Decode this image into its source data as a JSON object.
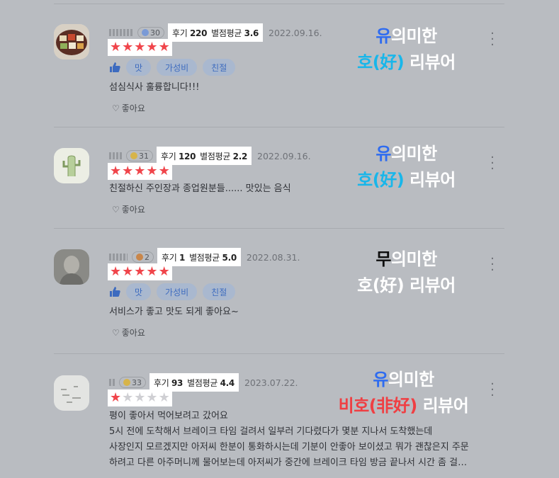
{
  "actions": {
    "like_label": "좋아요",
    "more_label": "⋮"
  },
  "reviews": [
    {
      "level": "30",
      "level_color": "#7a9ad6",
      "review_label": "후기",
      "review_count": "220",
      "avg_label": "별점평균",
      "avg_rating": "3.6",
      "date": "2022.09.16.",
      "stars_filled": 5,
      "tags": [
        "맛",
        "가성비",
        "친절"
      ],
      "text_lines": [
        "섬심식사 훌륭합니다!!!"
      ],
      "annotation": {
        "line1_colored": "유",
        "line1_rest": "의미한",
        "line2_colored": "호(好)",
        "line2_rest": " 리뷰어",
        "color1": "blue",
        "color2": "cyan"
      }
    },
    {
      "level": "31",
      "level_color": "#d7b44a",
      "review_label": "후기",
      "review_count": "120",
      "avg_label": "별점평균",
      "avg_rating": "2.2",
      "date": "2022.09.16.",
      "stars_filled": 5,
      "tags": [],
      "text_lines": [
        "친절하신 주인장과 종업원분들...... 맛있는 음식"
      ],
      "annotation": {
        "line1_colored": "유",
        "line1_rest": "의미한",
        "line2_colored": "호(好)",
        "line2_rest": " 리뷰어",
        "color1": "blue",
        "color2": "cyan"
      }
    },
    {
      "level": "2",
      "level_color": "#c9864a",
      "review_label": "후기",
      "review_count": "1",
      "avg_label": "별점평균",
      "avg_rating": "5.0",
      "date": "2022.08.31.",
      "stars_filled": 5,
      "tags": [
        "맛",
        "가성비",
        "친절"
      ],
      "text_lines": [
        "서비스가 좋고 맛도 되게 좋아요~"
      ],
      "annotation": {
        "line1_colored": "무",
        "line1_rest": "의미한",
        "line2_colored": "호(好)",
        "line2_rest": " 리뷰어",
        "color1": "black",
        "color2": "white"
      }
    },
    {
      "level": "33",
      "level_color": "#d7b44a",
      "review_label": "후기",
      "review_count": "93",
      "avg_label": "별점평균",
      "avg_rating": "4.4",
      "date": "2023.07.22.",
      "stars_filled": 1,
      "tags": [],
      "text_lines": [
        "평이 좋아서 먹어보려고 갔어요",
        "5시 전에 도착해서 브레이크 타임 걸려서 일부러 기다렸다가 몇분 지나서 도착했는데",
        "사장인지 모르겠지만 아저씨 한분이 통화하시는데 기분이 안좋아 보이셨고 뭐가 괜찮은지 주문",
        "하려고 다른 아주머니께 물어보는데 아저씨가 중간에 브레이크 타임 방금 끝나서 시간 좀 걸…"
      ],
      "annotation": {
        "line1_colored": "유",
        "line1_rest": "의미한",
        "line2_colored": "비호(非好)",
        "line2_rest": " 리뷰어",
        "color1": "blue",
        "color2": "red"
      }
    }
  ]
}
